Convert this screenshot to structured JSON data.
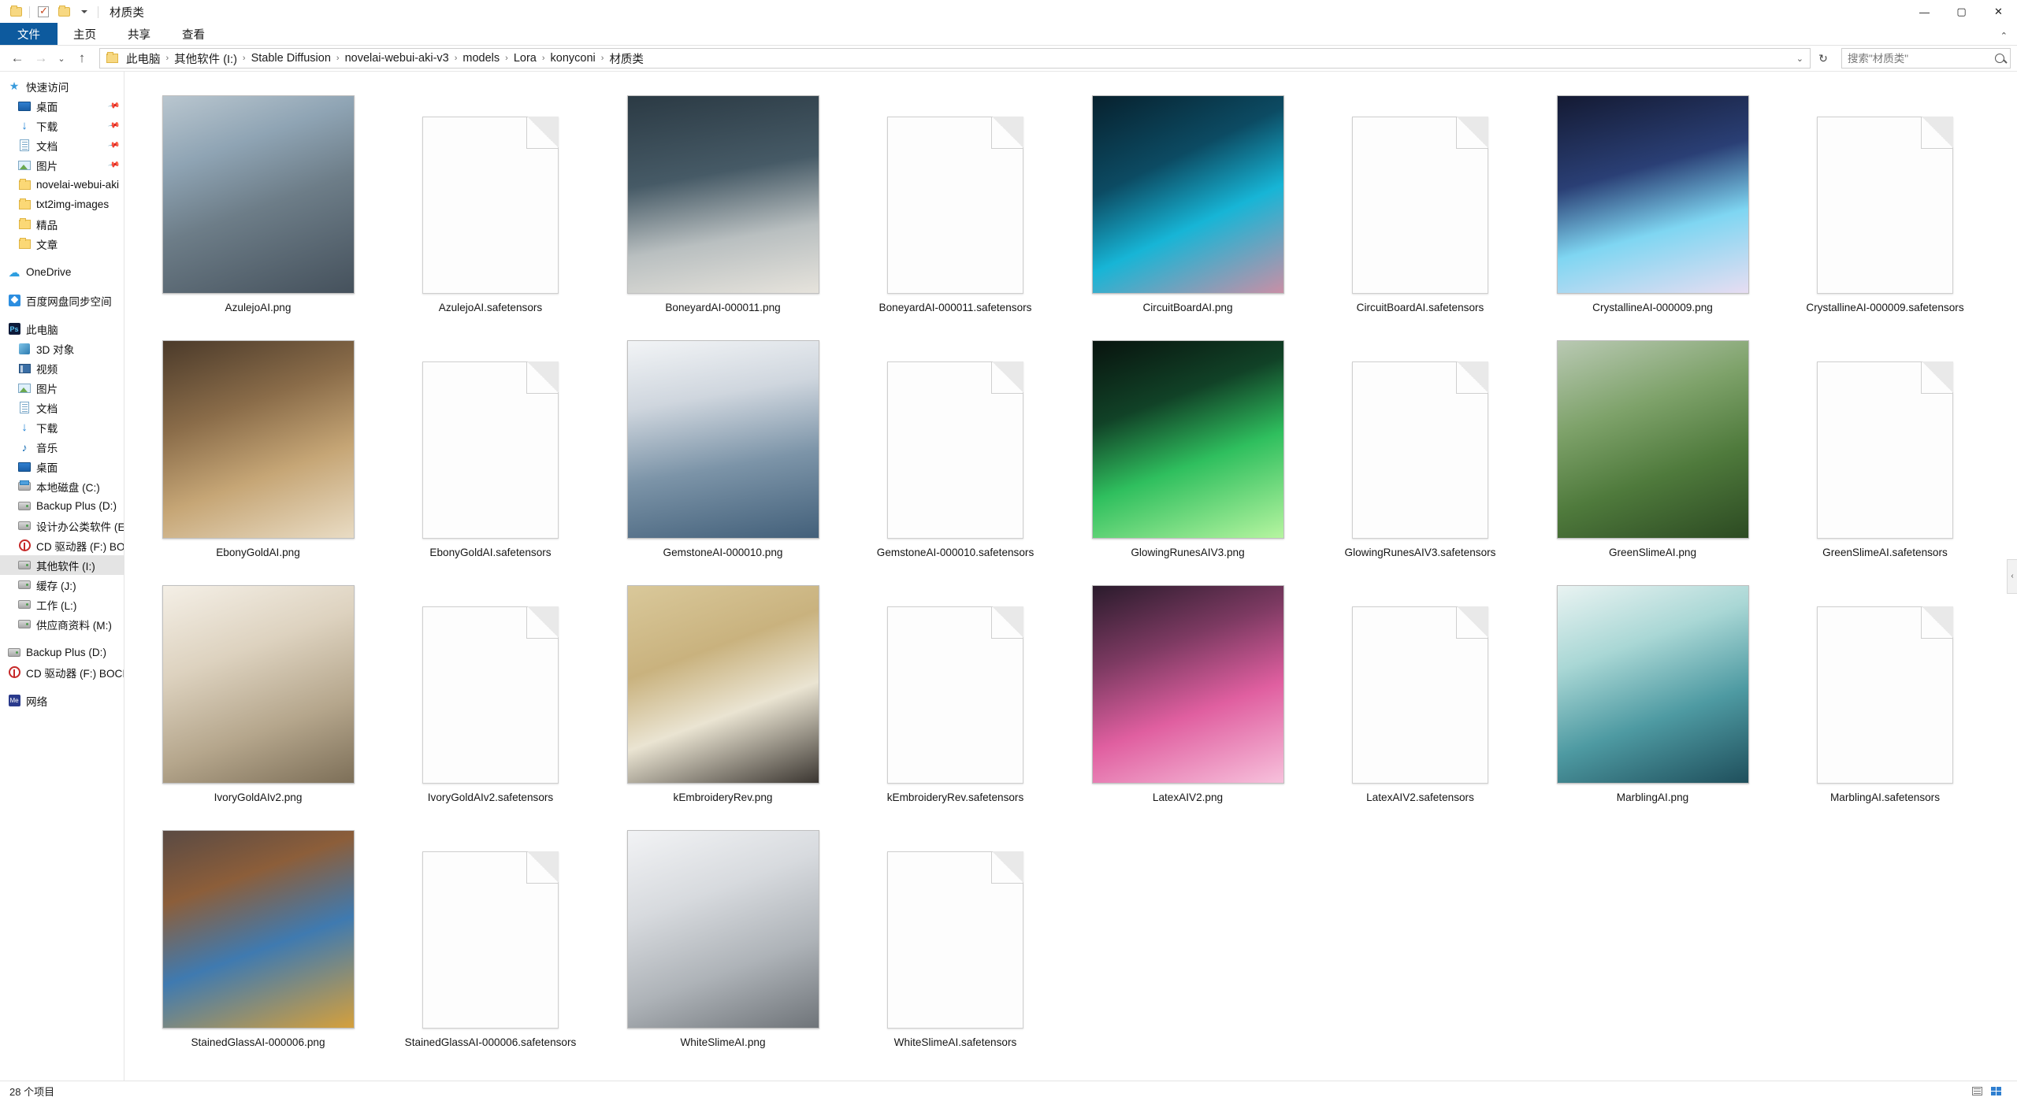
{
  "window": {
    "title": "材质类",
    "minimize": "—",
    "maximize": "▢",
    "close": "✕"
  },
  "ribbon": {
    "tabs": [
      {
        "label": "文件",
        "name": "tab-file"
      },
      {
        "label": "主页",
        "name": "tab-home"
      },
      {
        "label": "共享",
        "name": "tab-share"
      },
      {
        "label": "查看",
        "name": "tab-view"
      }
    ],
    "expand_caret": "⌃"
  },
  "address": {
    "back": "←",
    "forward": "→",
    "history": "⌄",
    "up": "↑",
    "separator": "›",
    "crumbs": [
      "此电脑",
      "其他软件 (I:)",
      "Stable Diffusion",
      "novelai-webui-aki-v3",
      "models",
      "Lora",
      "konyconi",
      "材质类"
    ],
    "dropdown": "⌄",
    "refresh": "↻",
    "search_placeholder": "搜索\"材质类\""
  },
  "sidebar": {
    "groups": [
      {
        "name": "quick-access",
        "items": [
          {
            "label": "快速访问",
            "icon": "star-icon",
            "indent": 0,
            "pin": false,
            "selected": false
          },
          {
            "label": "桌面",
            "icon": "desktop-icon",
            "indent": 1,
            "pin": true,
            "selected": false
          },
          {
            "label": "下载",
            "icon": "download-icon",
            "indent": 1,
            "pin": true,
            "selected": false
          },
          {
            "label": "文档",
            "icon": "document-icon",
            "indent": 1,
            "pin": true,
            "selected": false
          },
          {
            "label": "图片",
            "icon": "pictures-icon",
            "indent": 1,
            "pin": true,
            "selected": false
          },
          {
            "label": "novelai-webui-aki",
            "icon": "folder-icon",
            "indent": 1,
            "pin": false,
            "selected": false
          },
          {
            "label": "txt2img-images",
            "icon": "folder-icon",
            "indent": 1,
            "pin": false,
            "selected": false
          },
          {
            "label": "精品",
            "icon": "folder-icon",
            "indent": 1,
            "pin": false,
            "selected": false
          },
          {
            "label": "文章",
            "icon": "folder-icon",
            "indent": 1,
            "pin": false,
            "selected": false
          }
        ]
      },
      {
        "name": "onedrive",
        "items": [
          {
            "label": "OneDrive",
            "icon": "cloud-icon",
            "indent": 0,
            "pin": false,
            "selected": false
          }
        ]
      },
      {
        "name": "baidu-netdisk",
        "items": [
          {
            "label": "百度网盘同步空间",
            "icon": "baidu-icon",
            "indent": 0,
            "pin": false,
            "selected": false
          }
        ]
      },
      {
        "name": "this-pc",
        "items": [
          {
            "label": "此电脑",
            "icon": "pc-icon",
            "indent": 0,
            "pin": false,
            "selected": false
          },
          {
            "label": "3D 对象",
            "icon": "3d-objects-icon",
            "indent": 1,
            "pin": false,
            "selected": false
          },
          {
            "label": "视频",
            "icon": "videos-icon",
            "indent": 1,
            "pin": false,
            "selected": false
          },
          {
            "label": "图片",
            "icon": "pictures-icon",
            "indent": 1,
            "pin": false,
            "selected": false
          },
          {
            "label": "文档",
            "icon": "document-icon",
            "indent": 1,
            "pin": false,
            "selected": false
          },
          {
            "label": "下载",
            "icon": "download-icon",
            "indent": 1,
            "pin": false,
            "selected": false
          },
          {
            "label": "音乐",
            "icon": "music-icon",
            "indent": 1,
            "pin": false,
            "selected": false
          },
          {
            "label": "桌面",
            "icon": "desktop-icon",
            "indent": 1,
            "pin": false,
            "selected": false
          },
          {
            "label": "本地磁盘 (C:)",
            "icon": "system-drive-icon",
            "indent": 1,
            "pin": false,
            "selected": false
          },
          {
            "label": "Backup Plus (D:)",
            "icon": "drive-icon",
            "indent": 1,
            "pin": false,
            "selected": false
          },
          {
            "label": "设计办公类软件 (E:)",
            "icon": "drive-icon",
            "indent": 1,
            "pin": false,
            "selected": false
          },
          {
            "label": "CD 驱动器 (F:) BOCI",
            "icon": "cd-drive-icon",
            "indent": 1,
            "pin": false,
            "selected": false
          },
          {
            "label": "其他软件 (I:)",
            "icon": "drive-icon",
            "indent": 1,
            "pin": false,
            "selected": true
          },
          {
            "label": "缓存 (J:)",
            "icon": "drive-icon",
            "indent": 1,
            "pin": false,
            "selected": false
          },
          {
            "label": "工作 (L:)",
            "icon": "drive-icon",
            "indent": 1,
            "pin": false,
            "selected": false
          },
          {
            "label": "供应商资料 (M:)",
            "icon": "drive-icon",
            "indent": 1,
            "pin": false,
            "selected": false
          }
        ]
      },
      {
        "name": "devices",
        "items": [
          {
            "label": "Backup Plus (D:)",
            "icon": "drive-icon",
            "indent": 0,
            "pin": false,
            "selected": false
          },
          {
            "label": "CD 驱动器 (F:) BOCI",
            "icon": "cd-drive-icon",
            "indent": 0,
            "pin": false,
            "selected": false
          }
        ]
      },
      {
        "name": "network",
        "items": [
          {
            "label": "网络",
            "icon": "network-icon",
            "indent": 0,
            "pin": false,
            "selected": false
          }
        ]
      }
    ]
  },
  "files": [
    {
      "name": "AzulejoAI.png",
      "type": "image",
      "art": "tank-azulejo"
    },
    {
      "name": "AzulejoAI.safetensors",
      "type": "file"
    },
    {
      "name": "BoneyardAI-000011.png",
      "type": "image",
      "art": "skull-shoe"
    },
    {
      "name": "BoneyardAI-000011.safetensors",
      "type": "file"
    },
    {
      "name": "CircuitBoardAI.png",
      "type": "image",
      "art": "circuit-heels"
    },
    {
      "name": "CircuitBoardAI.safetensors",
      "type": "file"
    },
    {
      "name": "CrystallineAI-000009.png",
      "type": "image",
      "art": "crystal-machine"
    },
    {
      "name": "CrystallineAI-000009.safetensors",
      "type": "file"
    },
    {
      "name": "EbonyGoldAI.png",
      "type": "image",
      "art": "brass-espresso"
    },
    {
      "name": "EbonyGoldAI.safetensors",
      "type": "file"
    },
    {
      "name": "GemstoneAI-000010.png",
      "type": "image",
      "art": "gem-tank"
    },
    {
      "name": "GemstoneAI-000010.safetensors",
      "type": "file"
    },
    {
      "name": "GlowingRunesAIV3.png",
      "type": "image",
      "art": "rune-cube"
    },
    {
      "name": "GlowingRunesAIV3.safetensors",
      "type": "file"
    },
    {
      "name": "GreenSlimeAI.png",
      "type": "image",
      "art": "slime-car"
    },
    {
      "name": "GreenSlimeAI.safetensors",
      "type": "file"
    },
    {
      "name": "IvoryGoldAIv2.png",
      "type": "image",
      "art": "ivory-machine"
    },
    {
      "name": "IvoryGoldAIv2.safetensors",
      "type": "file"
    },
    {
      "name": "kEmbroideryRev.png",
      "type": "image",
      "art": "embroidery-coffee"
    },
    {
      "name": "kEmbroideryRev.safetensors",
      "type": "file"
    },
    {
      "name": "LatexAIV2.png",
      "type": "image",
      "art": "pink-tank"
    },
    {
      "name": "LatexAIV2.safetensors",
      "type": "file"
    },
    {
      "name": "MarblingAI.png",
      "type": "image",
      "art": "marble-toilet"
    },
    {
      "name": "MarblingAI.safetensors",
      "type": "file"
    },
    {
      "name": "StainedGlassAI-000006.png",
      "type": "image",
      "art": "stained-elephant"
    },
    {
      "name": "StainedGlassAI-000006.safetensors",
      "type": "file"
    },
    {
      "name": "WhiteSlimeAI.png",
      "type": "image",
      "art": "white-car"
    },
    {
      "name": "WhiteSlimeAI.safetensors",
      "type": "file"
    }
  ],
  "status": {
    "item_count": "28 个项目",
    "view_detail": "details-view",
    "view_tiles": "large-icons-view"
  },
  "collapse_handle": "‹"
}
